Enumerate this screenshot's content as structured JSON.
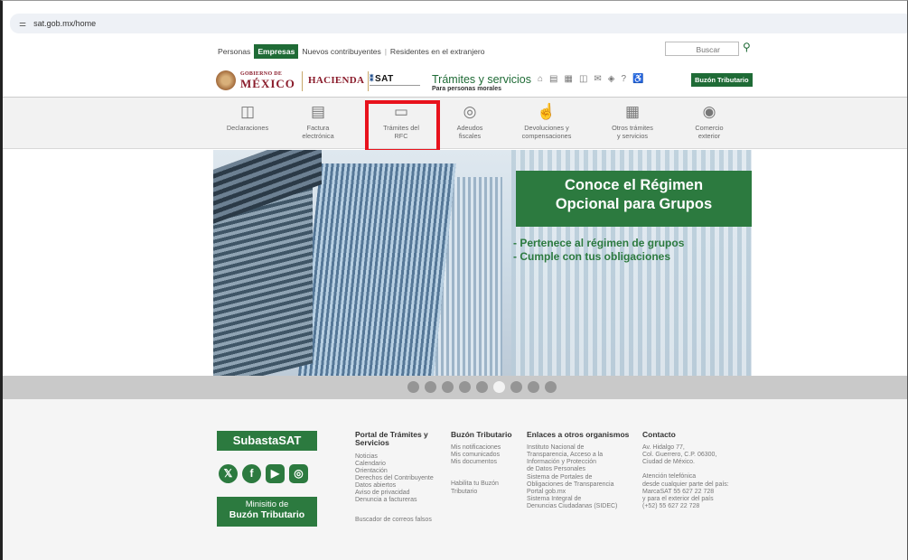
{
  "browser": {
    "url": "sat.gob.mx/home",
    "tune_icon": "tune-icon"
  },
  "topnav": {
    "items": [
      "Personas",
      "Empresas",
      "Nuevos contribuyentes",
      "Residentes en el extranjero"
    ],
    "search_placeholder": "Buscar"
  },
  "brand": {
    "gob_top": "GOBIERNO DE",
    "gob_main": "MÉXICO",
    "hacienda": "HACIENDA",
    "sat": "SAT",
    "title": "Trámites y servicios",
    "subtitle": "Para personas morales",
    "buzon_button": "Buzón Tributario"
  },
  "services": [
    {
      "l1": "Declaraciones",
      "l2": "",
      "icon": "◫"
    },
    {
      "l1": "Factura",
      "l2": "electrónica",
      "icon": "▤"
    },
    {
      "l1": "Trámites del",
      "l2": "RFC",
      "icon": "▭"
    },
    {
      "l1": "Adeudos",
      "l2": "fiscales",
      "icon": "◎"
    },
    {
      "l1": "Devoluciones y",
      "l2": "compensaciones",
      "icon": "☝"
    },
    {
      "l1": "Otros trámites",
      "l2": "y servicios",
      "icon": "▦"
    },
    {
      "l1": "Comercio",
      "l2": "exterior",
      "icon": "◉"
    }
  ],
  "hero": {
    "box_line1": "Conoce el Régimen",
    "box_line2": "Opcional para Grupos",
    "line1": "- Pertenece al régimen de grupos",
    "line2": "- Cumple con tus obligaciones"
  },
  "carousel": {
    "count": 9,
    "active_index": 5
  },
  "footer": {
    "subasta": "SubastaSAT",
    "social": [
      "𝕏",
      "f",
      "▶",
      "◎"
    ],
    "ministerio_1": "Minisitio de",
    "ministerio_2": "Buzón Tributario",
    "portal": {
      "title": "Portal de Trámites y Servicios",
      "links": [
        "Noticias",
        "Calendario",
        "Orientación",
        "Derechos del Contribuyente",
        "Datos abiertos",
        "Aviso de privacidad",
        "Denuncia a factureras"
      ],
      "extra": "Buscador de correos falsos"
    },
    "buzon": {
      "title": "Buzón Tributario",
      "links": [
        "Mis notificaciones",
        "Mis comunicados",
        "Mis documentos"
      ],
      "extra_1": "Habilita tu Buzón",
      "extra_2": "Tributario"
    },
    "enlaces": {
      "title": "Enlaces a otros organismos",
      "links": [
        "Instituto Nacional de",
        "Transparencia, Acceso a la",
        "Información y Protección",
        "de Datos Personales",
        "Sistema de Portales de",
        "Obligaciones de Transparencia",
        "Portal gob.mx",
        "Sistema Integral de",
        "Denuncias Ciudadanas (SIDEC)"
      ]
    },
    "contacto": {
      "title": "Contacto",
      "address": [
        "Av. Hidalgo 77,",
        "Col. Guerrero, C.P. 06300,",
        "Ciudad de México."
      ],
      "phone": [
        "Atención telefónica",
        "desde cualquier parte del país:",
        "MarcaSAT 55 627 22 728",
        "y para el exterior del país",
        "(+52) 55 627 22 728"
      ]
    }
  }
}
